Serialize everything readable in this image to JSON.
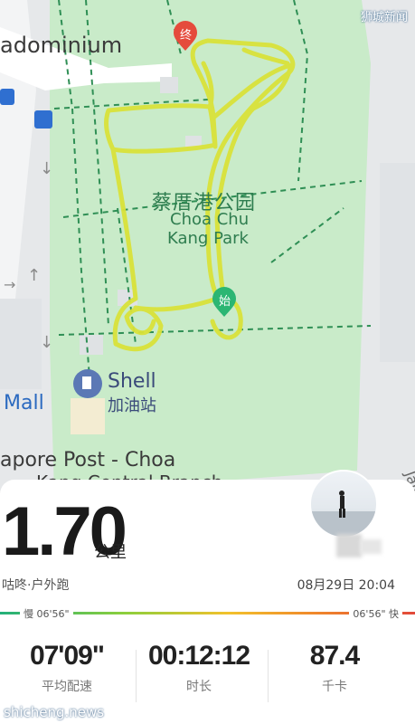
{
  "watermark": {
    "top": "狮城新闻",
    "bottom": "shicheng.news"
  },
  "map": {
    "labels": {
      "condo": "adominium",
      "park_cn": "蔡厝港公园",
      "park_en_line1": "Choa Chu",
      "park_en_line2": "Kang Park",
      "shell": "Shell",
      "shell_cn": "加油站",
      "mall": "Mall",
      "post_line1": "apore Post - Choa",
      "post_line2": "Kang Central Branch",
      "road": "Jalan"
    },
    "markers": {
      "end": "终",
      "start": "始"
    }
  },
  "summary": {
    "distance": "1.70",
    "distance_unit": "公里",
    "activity": "咕咚·户外跑",
    "datetime": "08月29日 20:04",
    "pace_slow": "慢 06'56\"",
    "pace_fast": "06'56\" 快"
  },
  "stats": [
    {
      "value": "07'09\"",
      "label": "平均配速"
    },
    {
      "value": "00:12:12",
      "label": "时长"
    },
    {
      "value": "87.4",
      "label": "千卡"
    }
  ],
  "colors": {
    "route": "#d9e23a",
    "park": "#c9ebc9",
    "start_marker": "#2bb673",
    "end_marker": "#e54b3c"
  }
}
